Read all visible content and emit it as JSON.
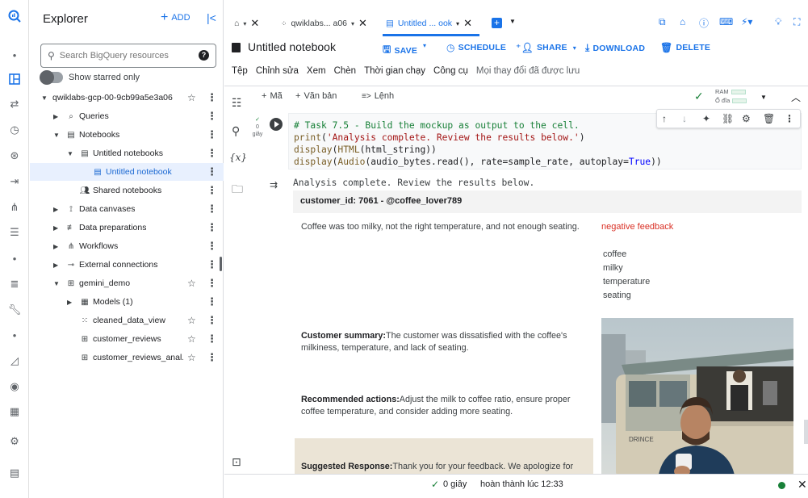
{
  "explorer": {
    "title": "Explorer",
    "add_label": "ADD",
    "search_placeholder": "Search BigQuery resources",
    "starred_label": "Show starred only",
    "tree": [
      {
        "label": "qwiklabs-gcp-00-9cb99a5e3a06",
        "icon": "project-icon",
        "level": 0,
        "expanded": true,
        "star": true
      },
      {
        "label": "Queries",
        "icon": "queries-icon",
        "level": 1,
        "expanded": false,
        "star": false
      },
      {
        "label": "Notebooks",
        "icon": "notebook-icon",
        "level": 1,
        "expanded": true,
        "star": false
      },
      {
        "label": "Untitled notebooks",
        "icon": "notebook-icon",
        "level": 2,
        "expanded": true,
        "star": false
      },
      {
        "label": "Untitled notebook",
        "icon": "notebook-icon",
        "level": 3,
        "selected": true,
        "star": false
      },
      {
        "label": "Shared notebooks",
        "icon": "shared-icon",
        "level": 2,
        "star": false
      },
      {
        "label": "Data canvases",
        "icon": "canvas-icon",
        "level": 1,
        "expanded": false,
        "star": false
      },
      {
        "label": "Data preparations",
        "icon": "data-prep-icon",
        "level": 1,
        "expanded": false,
        "star": false
      },
      {
        "label": "Workflows",
        "icon": "workflow-icon",
        "level": 1,
        "expanded": false,
        "star": false
      },
      {
        "label": "External connections",
        "icon": "connection-icon",
        "level": 1,
        "expanded": false,
        "star": false
      },
      {
        "label": "gemini_demo",
        "icon": "dataset-icon",
        "level": 1,
        "expanded": true,
        "star": true
      },
      {
        "label": "Models (1)",
        "icon": "model-icon",
        "level": 2,
        "expanded": false,
        "star": false
      },
      {
        "label": "cleaned_data_view",
        "icon": "view-icon",
        "level": 2,
        "star": true
      },
      {
        "label": "customer_reviews",
        "icon": "table-icon",
        "level": 2,
        "star": true
      },
      {
        "label": "customer_reviews_anal...",
        "icon": "table-icon",
        "level": 2,
        "star": true
      }
    ]
  },
  "tabs": [
    {
      "label": "qwiklabs... a06",
      "icon": "project-icon"
    },
    {
      "label": "Untitled ... ook",
      "icon": "notebook-icon",
      "active": true
    }
  ],
  "notebook": {
    "title": "Untitled notebook",
    "save_label": "SAVE",
    "schedule_label": "SCHEDULE",
    "share_label": "SHARE",
    "download_label": "DOWNLOAD",
    "delete_label": "DELETE"
  },
  "menu": {
    "items": [
      "Tệp",
      "Chỉnh sửa",
      "Xem",
      "Chèn",
      "Thời gian chạy",
      "Công cụ"
    ],
    "saved_status": "Mọi thay đổi đã được lưu"
  },
  "cell_toolbar": {
    "add_code_label": "Mã",
    "add_text_label": "Văn bản",
    "command_label": "Lệnh",
    "ram_label": "RAM",
    "disk_label": "Ổ đĩa"
  },
  "cell": {
    "status_time": "0 giây",
    "code_lines": [
      "# Task 7.5 - Build the mockup as output to the cell.",
      "print('Analysis complete. Review the results below.')",
      "display(HTML(html_string))",
      "display(Audio(audio_bytes.read(), rate=sample_rate, autoplay=True))"
    ]
  },
  "output": {
    "print_text": "Analysis complete. Review the results below.",
    "customer_header": "customer_id: 7061 - @coffee_lover789",
    "review_text": "Coffee was too milky, not the right temperature, and not enough seating.",
    "sentiment_label": "negative feedback",
    "keywords": [
      "coffee",
      "milky",
      "temperature",
      "seating"
    ],
    "summary_label": "Customer summary:",
    "summary_text": "The customer was dissatisfied with the coffee's milkiness, temperature, and lack of seating.",
    "actions_label": "Recommended actions:",
    "actions_text": "Adjust the milk to coffee ratio, ensure proper coffee temperature, and consider adding more seating.",
    "response_label": "Suggested Response:",
    "response_text": "Thank you for your feedback. We apologize for",
    "truck_sign": "DRINCE"
  },
  "status": {
    "time": "0 giây",
    "done": "hoàn thành lúc 12:33"
  },
  "colors": {
    "accent": "#1a73e8",
    "success": "#188038",
    "negative": "#d93025"
  }
}
